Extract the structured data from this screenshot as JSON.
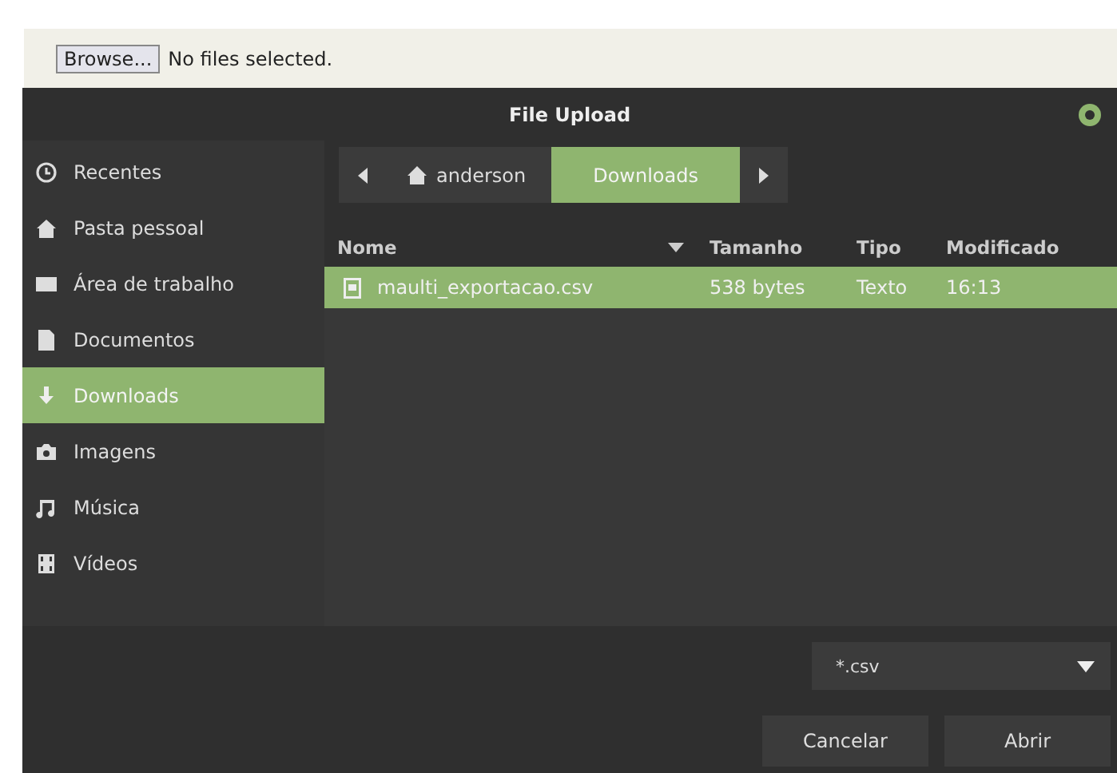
{
  "page": {
    "browse_button": "Browse...",
    "file_status": "No files selected."
  },
  "dialog": {
    "title": "File Upload",
    "sidebar": [
      {
        "kind": "clock",
        "label": "Recentes",
        "selected": false
      },
      {
        "kind": "home",
        "label": "Pasta pessoal",
        "selected": false
      },
      {
        "kind": "desktop",
        "label": "Área de trabalho",
        "selected": false
      },
      {
        "kind": "document",
        "label": "Documentos",
        "selected": false
      },
      {
        "kind": "download",
        "label": "Downloads",
        "selected": true
      },
      {
        "kind": "camera",
        "label": "Imagens",
        "selected": false
      },
      {
        "kind": "music",
        "label": "Música",
        "selected": false
      },
      {
        "kind": "film",
        "label": "Vídeos",
        "selected": false
      }
    ],
    "path": [
      {
        "label": "anderson",
        "home": true,
        "selected": false
      },
      {
        "label": "Downloads",
        "home": false,
        "selected": true
      }
    ],
    "table": {
      "columns": [
        "Nome",
        "Tamanho",
        "Tipo",
        "Modificado"
      ],
      "rows": [
        {
          "cells": [
            "maulti_exportacao.csv",
            "538 bytes",
            "Texto",
            "16:13"
          ],
          "selected": true
        }
      ]
    },
    "filter": "*.csv",
    "buttons": [
      "Cancelar",
      "Abrir"
    ]
  }
}
